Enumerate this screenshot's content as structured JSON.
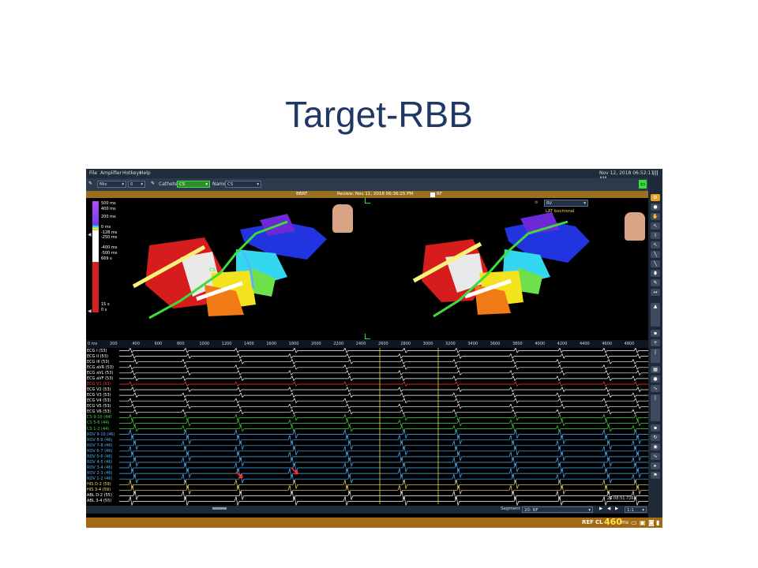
{
  "slide": {
    "title": "Target-RBB"
  },
  "menu": [
    "File",
    "Amplifier",
    "Hotkeys",
    "Help"
  ],
  "datetime": "Nov 12, 2018 06:52:11 AM",
  "toolbar": {
    "map_select": "Mix",
    "catheter_label": "Catheter:",
    "catheter_value": "CS",
    "name_label": "Name:",
    "name_value": "CS"
  },
  "review_bar": {
    "map_name": "BBRT",
    "review_text": "Review: Nov 11, 2018 06:36:25 PM",
    "rf_label": "RF"
  },
  "map_view": {
    "right_dropdown": "RV",
    "map_type": "LAT Isochronal",
    "cs_label": "CS",
    "scale_top": [
      "500 ms",
      "400 ms",
      "200 ms"
    ],
    "scale_mid": [
      "0 ms",
      "-128 ms",
      "-250 ms",
      "-400 ms",
      "-500 ms",
      "669 s"
    ],
    "scale_bottom": [
      "15 s",
      "0 s"
    ]
  },
  "ruler": {
    "start": "0 ms",
    "ticks": [
      "200",
      "400",
      "600",
      "800",
      "1000",
      "1200",
      "1400",
      "1600",
      "1800",
      "2000",
      "2200",
      "2400",
      "2600",
      "2800",
      "3000",
      "3200",
      "3400",
      "3600",
      "3800",
      "4000",
      "4200",
      "4400",
      "4600",
      "4800"
    ]
  },
  "channels": [
    {
      "label": "ECG I (53)",
      "color": "#ffffff"
    },
    {
      "label": "ECG II (53)",
      "color": "#ffffff"
    },
    {
      "label": "ECG III (53)",
      "color": "#ffffff"
    },
    {
      "label": "ECG aVR (53)",
      "color": "#ffffff"
    },
    {
      "label": "ECG aVL (53)",
      "color": "#ffffff"
    },
    {
      "label": "ECG aVF (53)",
      "color": "#ffffff"
    },
    {
      "label": "ECG V1 (53)",
      "color": "#ff3b3b"
    },
    {
      "label": "ECG V2 (53)",
      "color": "#ffffff"
    },
    {
      "label": "ECG V3 (53)",
      "color": "#ffffff"
    },
    {
      "label": "ECG V4 (53)",
      "color": "#ffffff"
    },
    {
      "label": "ECG V5 (53)",
      "color": "#ffffff"
    },
    {
      "label": "ECG V6 (53)",
      "color": "#ffffff"
    },
    {
      "label": "CS 9-10 (44)",
      "color": "#46d93e"
    },
    {
      "label": "CS 5-6 (44)",
      "color": "#46d93e"
    },
    {
      "label": "CS 1-2 (44)",
      "color": "#46d93e"
    },
    {
      "label": "ROV 9-10 (46)",
      "color": "#4fb7ff"
    },
    {
      "label": "ROV 8-9 (46)",
      "color": "#4fb7ff"
    },
    {
      "label": "ROV 7-8 (46)",
      "color": "#4fb7ff"
    },
    {
      "label": "ROV 6-7 (46)",
      "color": "#4fb7ff"
    },
    {
      "label": "ROV 5-6 (46)",
      "color": "#4fb7ff"
    },
    {
      "label": "ROV 4-5 (46)",
      "color": "#4fb7ff"
    },
    {
      "label": "ROV 3-4 (46)",
      "color": "#4fb7ff"
    },
    {
      "label": "ROV 2-3 (46)",
      "color": "#4fb7ff"
    },
    {
      "label": "ROV 1-2 (46)",
      "color": "#4fb7ff"
    },
    {
      "label": "HIS D-2 (59)",
      "color": "#f3e26a"
    },
    {
      "label": "HIS 3-4 (59)",
      "color": "#f3e26a"
    },
    {
      "label": "ABL D-2 (55)",
      "color": "#ffffff"
    },
    {
      "label": "ABL 3-4 (55)",
      "color": "#ffffff"
    }
  ],
  "trace_timestamp": "23:08:51.726",
  "bottom_bar": {
    "segment_label": "Segment",
    "segment_value": "20: RF",
    "speed": "1:1"
  },
  "status_bar": {
    "ref": "REF",
    "cl_label": "CL",
    "cl_value": "460",
    "cl_unit": "ms"
  },
  "colors": {
    "title": "#1f3864",
    "status_bar": "#a36a14",
    "accent_green": "#3ddc3d"
  }
}
